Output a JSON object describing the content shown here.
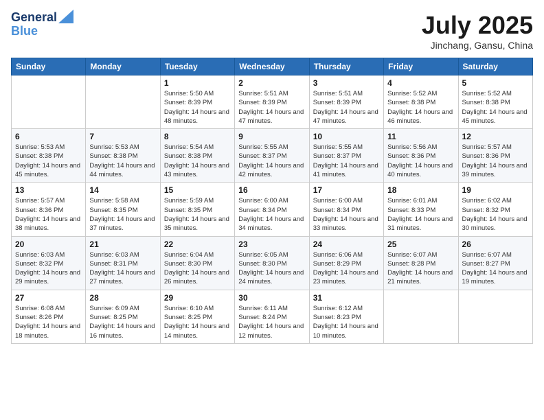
{
  "header": {
    "logo_line1": "General",
    "logo_line2": "Blue",
    "month": "July 2025",
    "location": "Jinchang, Gansu, China"
  },
  "weekdays": [
    "Sunday",
    "Monday",
    "Tuesday",
    "Wednesday",
    "Thursday",
    "Friday",
    "Saturday"
  ],
  "weeks": [
    [
      {
        "day": "",
        "info": ""
      },
      {
        "day": "",
        "info": ""
      },
      {
        "day": "1",
        "info": "Sunrise: 5:50 AM\nSunset: 8:39 PM\nDaylight: 14 hours and 48 minutes."
      },
      {
        "day": "2",
        "info": "Sunrise: 5:51 AM\nSunset: 8:39 PM\nDaylight: 14 hours and 47 minutes."
      },
      {
        "day": "3",
        "info": "Sunrise: 5:51 AM\nSunset: 8:39 PM\nDaylight: 14 hours and 47 minutes."
      },
      {
        "day": "4",
        "info": "Sunrise: 5:52 AM\nSunset: 8:38 PM\nDaylight: 14 hours and 46 minutes."
      },
      {
        "day": "5",
        "info": "Sunrise: 5:52 AM\nSunset: 8:38 PM\nDaylight: 14 hours and 45 minutes."
      }
    ],
    [
      {
        "day": "6",
        "info": "Sunrise: 5:53 AM\nSunset: 8:38 PM\nDaylight: 14 hours and 45 minutes."
      },
      {
        "day": "7",
        "info": "Sunrise: 5:53 AM\nSunset: 8:38 PM\nDaylight: 14 hours and 44 minutes."
      },
      {
        "day": "8",
        "info": "Sunrise: 5:54 AM\nSunset: 8:38 PM\nDaylight: 14 hours and 43 minutes."
      },
      {
        "day": "9",
        "info": "Sunrise: 5:55 AM\nSunset: 8:37 PM\nDaylight: 14 hours and 42 minutes."
      },
      {
        "day": "10",
        "info": "Sunrise: 5:55 AM\nSunset: 8:37 PM\nDaylight: 14 hours and 41 minutes."
      },
      {
        "day": "11",
        "info": "Sunrise: 5:56 AM\nSunset: 8:36 PM\nDaylight: 14 hours and 40 minutes."
      },
      {
        "day": "12",
        "info": "Sunrise: 5:57 AM\nSunset: 8:36 PM\nDaylight: 14 hours and 39 minutes."
      }
    ],
    [
      {
        "day": "13",
        "info": "Sunrise: 5:57 AM\nSunset: 8:36 PM\nDaylight: 14 hours and 38 minutes."
      },
      {
        "day": "14",
        "info": "Sunrise: 5:58 AM\nSunset: 8:35 PM\nDaylight: 14 hours and 37 minutes."
      },
      {
        "day": "15",
        "info": "Sunrise: 5:59 AM\nSunset: 8:35 PM\nDaylight: 14 hours and 35 minutes."
      },
      {
        "day": "16",
        "info": "Sunrise: 6:00 AM\nSunset: 8:34 PM\nDaylight: 14 hours and 34 minutes."
      },
      {
        "day": "17",
        "info": "Sunrise: 6:00 AM\nSunset: 8:34 PM\nDaylight: 14 hours and 33 minutes."
      },
      {
        "day": "18",
        "info": "Sunrise: 6:01 AM\nSunset: 8:33 PM\nDaylight: 14 hours and 31 minutes."
      },
      {
        "day": "19",
        "info": "Sunrise: 6:02 AM\nSunset: 8:32 PM\nDaylight: 14 hours and 30 minutes."
      }
    ],
    [
      {
        "day": "20",
        "info": "Sunrise: 6:03 AM\nSunset: 8:32 PM\nDaylight: 14 hours and 29 minutes."
      },
      {
        "day": "21",
        "info": "Sunrise: 6:03 AM\nSunset: 8:31 PM\nDaylight: 14 hours and 27 minutes."
      },
      {
        "day": "22",
        "info": "Sunrise: 6:04 AM\nSunset: 8:30 PM\nDaylight: 14 hours and 26 minutes."
      },
      {
        "day": "23",
        "info": "Sunrise: 6:05 AM\nSunset: 8:30 PM\nDaylight: 14 hours and 24 minutes."
      },
      {
        "day": "24",
        "info": "Sunrise: 6:06 AM\nSunset: 8:29 PM\nDaylight: 14 hours and 23 minutes."
      },
      {
        "day": "25",
        "info": "Sunrise: 6:07 AM\nSunset: 8:28 PM\nDaylight: 14 hours and 21 minutes."
      },
      {
        "day": "26",
        "info": "Sunrise: 6:07 AM\nSunset: 8:27 PM\nDaylight: 14 hours and 19 minutes."
      }
    ],
    [
      {
        "day": "27",
        "info": "Sunrise: 6:08 AM\nSunset: 8:26 PM\nDaylight: 14 hours and 18 minutes."
      },
      {
        "day": "28",
        "info": "Sunrise: 6:09 AM\nSunset: 8:25 PM\nDaylight: 14 hours and 16 minutes."
      },
      {
        "day": "29",
        "info": "Sunrise: 6:10 AM\nSunset: 8:25 PM\nDaylight: 14 hours and 14 minutes."
      },
      {
        "day": "30",
        "info": "Sunrise: 6:11 AM\nSunset: 8:24 PM\nDaylight: 14 hours and 12 minutes."
      },
      {
        "day": "31",
        "info": "Sunrise: 6:12 AM\nSunset: 8:23 PM\nDaylight: 14 hours and 10 minutes."
      },
      {
        "day": "",
        "info": ""
      },
      {
        "day": "",
        "info": ""
      }
    ]
  ]
}
